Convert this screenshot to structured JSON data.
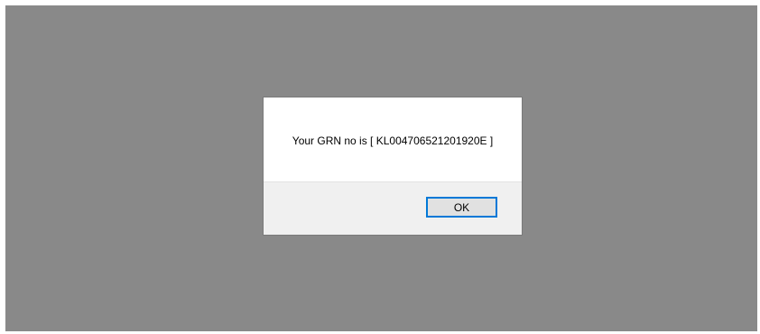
{
  "dialog": {
    "message": "Your GRN no is [ KL004706521201920E ]",
    "ok_label": "OK"
  },
  "colors": {
    "overlay": "#898989",
    "dialog_background": "#ffffff",
    "footer_background": "#f0f0f0",
    "button_border": "#0078d7",
    "button_background": "#e1e1e1"
  }
}
